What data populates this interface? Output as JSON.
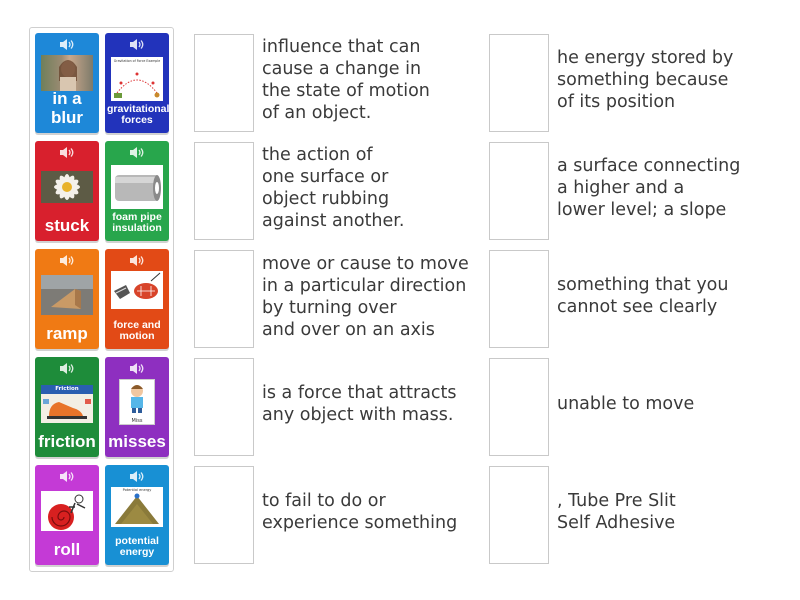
{
  "cards": [
    {
      "label": "in a blur",
      "style": "big",
      "color": "#1e88d8",
      "image": "blurred-person-photo"
    },
    {
      "label": "gravitational forces",
      "style": "small",
      "color": "#2233bb",
      "image": "gravitation-diagram"
    },
    {
      "label": "stuck",
      "style": "big",
      "color": "#d8202d",
      "image": "daisy-flower-photo"
    },
    {
      "label": "foam pipe insulation",
      "style": "small",
      "color": "#28a64c",
      "image": "foam-pipe-photo"
    },
    {
      "label": "ramp",
      "style": "big",
      "color": "#f07a14",
      "image": "wooden-ramp-photo"
    },
    {
      "label": "force and motion",
      "style": "small",
      "color": "#e24a16",
      "image": "force-motion-illustration"
    },
    {
      "label": "friction",
      "style": "big",
      "color": "#1e8c3a",
      "image": "friction-shoe-poster"
    },
    {
      "label": "misses",
      "style": "big",
      "color": "#8e2fc0",
      "image": "boy-cartoon-card"
    },
    {
      "label": "roll",
      "style": "big",
      "color": "#c43ad6",
      "image": "rolling-person-cartoon"
    },
    {
      "label": "potential energy",
      "style": "small",
      "color": "#1890d4",
      "image": "ball-on-hill-diagram"
    }
  ],
  "image_text": {
    "gravitation_title": "Gravitation of Force Example",
    "friction_title": "Friction",
    "boy_caption": "Miss",
    "potential_caption": "Potential energy"
  },
  "definitions_left": [
    "influence that can\ncause a change in\nthe state of motion\nof an object.",
    "the action of\none surface or\nobject rubbing\nagainst another.",
    "move or cause to move\nin a particular direction\nby turning over\nand over on an axis",
    "is a force that attracts\nany object with mass.",
    "to fail to do or\nexperience something"
  ],
  "definitions_right": [
    "he energy stored by\nsomething because\nof its position",
    "a surface connecting\na higher and a\nlower level; a slope",
    "something that you\ncannot see clearly",
    "unable to move",
    ", Tube Pre Slit\nSelf Adhesive"
  ]
}
